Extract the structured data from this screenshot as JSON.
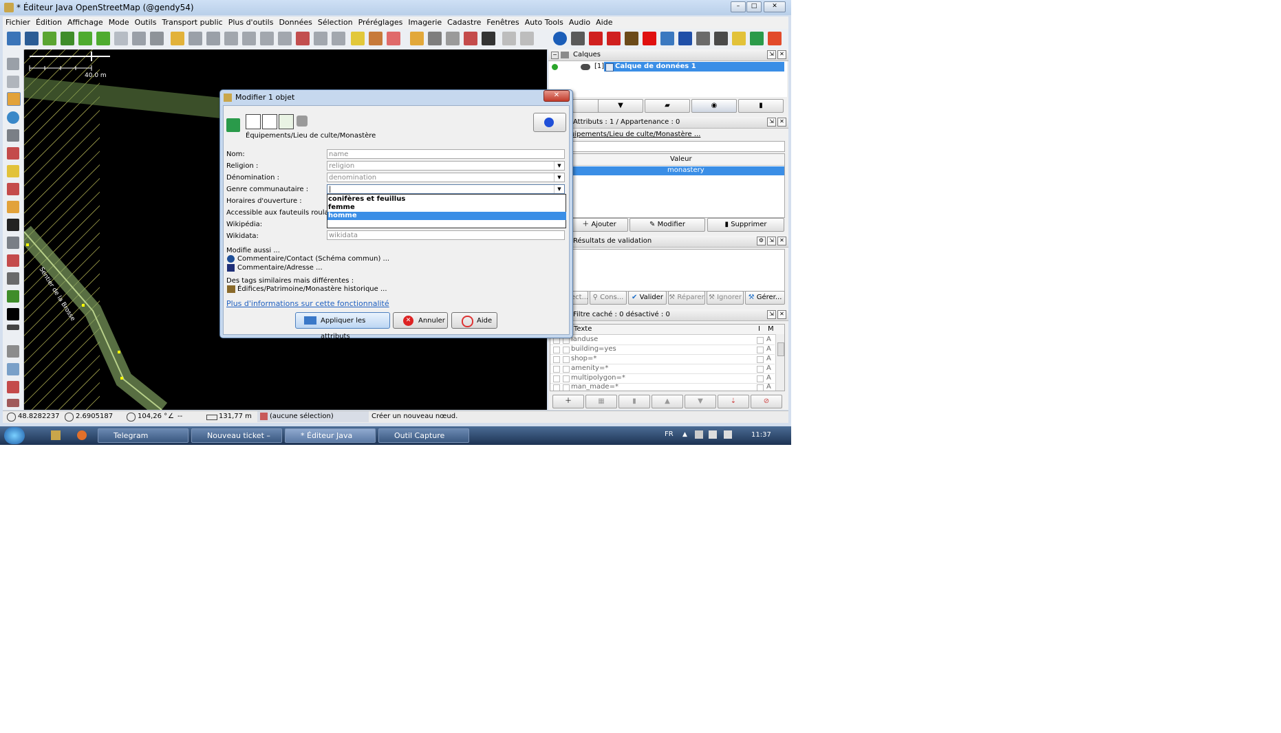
{
  "window": {
    "title": "* Éditeur Java OpenStreetMap (@gendy54)",
    "controls": {
      "minimize": "–",
      "maximize": "□",
      "close": "✕"
    }
  },
  "menu": [
    "Fichier",
    "Édition",
    "Affichage",
    "Mode",
    "Outils",
    "Transport public",
    "Plus d'outils",
    "Données",
    "Sélection",
    "Préréglages",
    "Imagerie",
    "Cadastre",
    "Fenêtres",
    "Auto Tools",
    "Audio",
    "Aide"
  ],
  "map": {
    "scale_label": "40.0 m",
    "street_label": "Sentier de la Brosse"
  },
  "panels": {
    "layers": {
      "title": "Calques",
      "layer_index": "[1]",
      "layer_name": "Calque de données 1"
    },
    "tags": {
      "title": "Attributs : 1 / Appartenance : 0",
      "preset_link": "uipements/Lieu de culte/Monastère ...",
      "col_value": "Valeur",
      "value": "monastery",
      "add": "Ajouter",
      "edit": "Modifier",
      "delete": "Supprimer"
    },
    "validation": {
      "title": "Résultats de validation",
      "buttons": [
        "ect...",
        "Cons...",
        "Valider",
        "Réparer",
        "Ignorer",
        "Gérer..."
      ]
    },
    "filter": {
      "title": "Filtre caché : 0 désactivé : 0",
      "col_text": "Texte",
      "col_i": "I",
      "col_m": "M",
      "rows": [
        "landuse",
        "building=yes",
        "shop=*",
        "amenity=*",
        "multipolygon=*",
        "man_made=*"
      ],
      "row_flag": "A"
    }
  },
  "statusbar": {
    "lat": "48.8282237",
    "lon": "2.6905187",
    "heading": "104,26 °",
    "angle": "--",
    "distance": "131,77 m",
    "selection": "(aucune sélection)",
    "hint": "Créer un nouveau nœud."
  },
  "taskbar": {
    "tasks": [
      "Telegram",
      "Nouveau ticket – JOS...",
      "* Éditeur Java OpenS...",
      "Outil Capture"
    ],
    "lang": "FR",
    "clock": "11:37"
  },
  "dialog": {
    "title": "Modifier 1 objet",
    "preset_path": "Équipements/Lieu de culte/Monastère",
    "fields": [
      {
        "label": "Nom:",
        "placeholder": "name",
        "combo": false
      },
      {
        "label": "Religion :",
        "placeholder": "religion",
        "combo": true
      },
      {
        "label": "Dénomination :",
        "placeholder": "denomination",
        "combo": true
      },
      {
        "label": "Genre communautaire :",
        "placeholder": "",
        "combo": true
      },
      {
        "label": "Horaires d'ouverture :",
        "placeholder": "",
        "combo": false
      },
      {
        "label": "Accessible aux fauteuils roulants :",
        "placeholder": "",
        "combo": false
      },
      {
        "label": "Wikipédia:",
        "placeholder": "",
        "combo": false
      },
      {
        "label": "Wikidata:",
        "placeholder": "wikidata",
        "combo": false
      }
    ],
    "dropdown_options": [
      "conifères et feuillus",
      "femme",
      "homme"
    ],
    "dropdown_selected": "homme",
    "also_modifies_title": "Modifie aussi ...",
    "also_modifies": [
      "Commentaire/Contact (Schéma commun) ...",
      "Commentaire/Adresse ..."
    ],
    "similar_title": "Des tags similaires mais différentes :",
    "similar": [
      "Édifices/Patrimoine/Monastère historique ..."
    ],
    "more_info_link": "Plus d'informations sur cette fonctionnalité",
    "apply": "Appliquer les attributs",
    "cancel": "Annuler",
    "help": "Aide"
  }
}
